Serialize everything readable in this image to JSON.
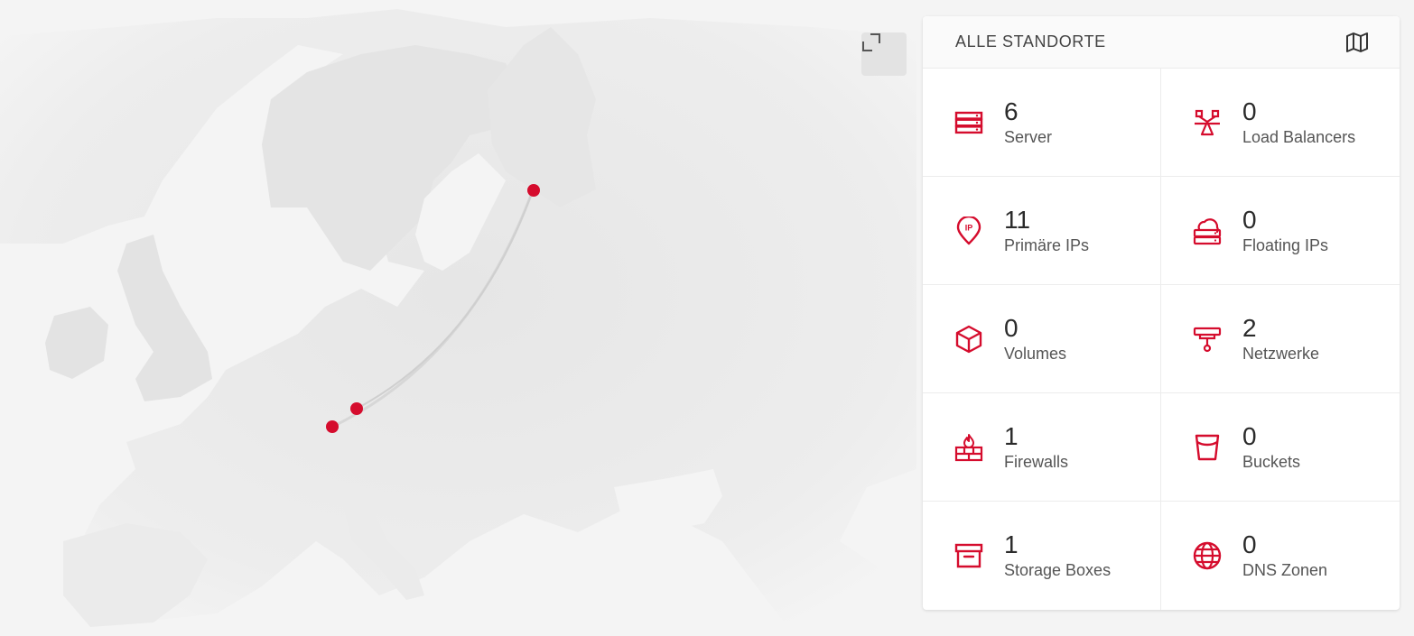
{
  "colors": {
    "accent": "#d50c2d",
    "background": "#f4f4f4",
    "land": "#e8e8e8"
  },
  "map": {
    "fullscreen_icon": "expand-icon",
    "locations": [
      {
        "name": "falkenstein-marker"
      },
      {
        "name": "nuremberg-marker"
      },
      {
        "name": "helsinki-marker"
      }
    ]
  },
  "panel": {
    "title": "ALLE STANDORTE",
    "title_icon": "map-icon",
    "tiles": [
      {
        "count": "6",
        "label": "Server",
        "icon": "server-icon"
      },
      {
        "count": "0",
        "label": "Load Balancers",
        "icon": "load-balancer-icon"
      },
      {
        "count": "11",
        "label": "Primäre IPs",
        "icon": "ip-pin-icon"
      },
      {
        "count": "0",
        "label": "Floating IPs",
        "icon": "floating-ip-icon"
      },
      {
        "count": "0",
        "label": "Volumes",
        "icon": "volume-cube-icon"
      },
      {
        "count": "2",
        "label": "Netzwerke",
        "icon": "network-icon"
      },
      {
        "count": "1",
        "label": "Firewalls",
        "icon": "firewall-icon"
      },
      {
        "count": "0",
        "label": "Buckets",
        "icon": "bucket-icon"
      },
      {
        "count": "1",
        "label": "Storage Boxes",
        "icon": "storage-box-icon"
      },
      {
        "count": "0",
        "label": "DNS Zonen",
        "icon": "globe-icon"
      }
    ]
  }
}
